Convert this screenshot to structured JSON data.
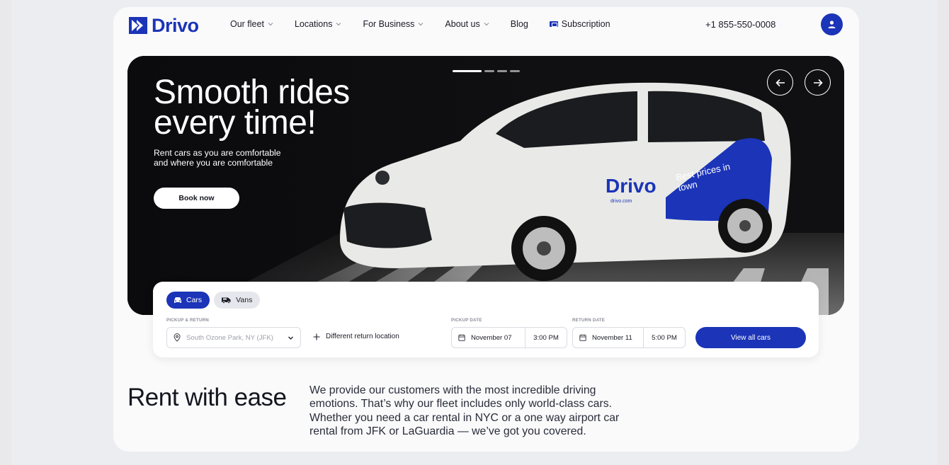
{
  "brand": {
    "name": "Drivo",
    "color": "#1b34b8"
  },
  "nav": {
    "items": [
      {
        "label": "Our fleet",
        "dropdown": true
      },
      {
        "label": "Locations",
        "dropdown": true
      },
      {
        "label": "For Business",
        "dropdown": true
      },
      {
        "label": "About us",
        "dropdown": true
      },
      {
        "label": "Blog",
        "dropdown": false
      }
    ],
    "subscription_label": "Subscription",
    "phone": "+1 855-550-0008",
    "user_icon": "user-icon"
  },
  "hero": {
    "title": "Smooth rides every time!",
    "subtitle": "Rent cars as you are comfortable and where you are comfortable",
    "book_label": "Book now",
    "slides_total": 4,
    "slide_active": 1,
    "car_decal_brand": "Drivo",
    "car_decal_url": "drivo.com",
    "car_decal_slogan": "Best prices in town"
  },
  "booking": {
    "tabs": [
      {
        "label": "Cars",
        "icon": "car-icon",
        "active": true
      },
      {
        "label": "Vans",
        "icon": "van-icon",
        "active": false
      }
    ],
    "pickup_return_label": "PICKUP & RETURN",
    "location_value": "South Ozone Park, NY (JFK)",
    "different_return_label": "Different return location",
    "pickup_date_label": "PICKUP DATE",
    "pickup_date": "November 07",
    "pickup_time": "3:00 PM",
    "return_date_label": "RETURN DATE",
    "return_date": "November 11",
    "return_time": "5:00 PM",
    "view_all_label": "View all cars"
  },
  "about": {
    "title": "Rent with ease",
    "text": "We provide our customers with the most incredible driving emotions. That’s why our fleet includes only world-class cars. Whether you need a car rental in NYC or a one way airport car rental from JFK or LaGuardia — we’ve got you covered."
  }
}
